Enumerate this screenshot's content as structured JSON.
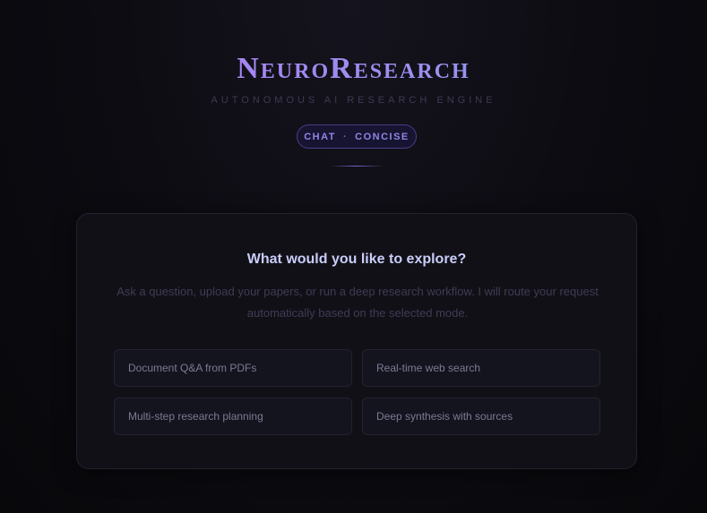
{
  "brand": {
    "name": "NeuroResearch",
    "tagline": "AUTONOMOUS AI RESEARCH ENGINE"
  },
  "mode": {
    "type": "CHAT",
    "separator": "·",
    "style": "CONCISE"
  },
  "welcome": {
    "title": "What would you like to explore?",
    "description": "Ask a question, upload your papers, or run a deep research workflow. I will route your request automatically based on the selected mode.",
    "options": [
      {
        "label": "Document Q&A from PDFs"
      },
      {
        "label": "Real-time web search"
      },
      {
        "label": "Multi-step research planning"
      },
      {
        "label": "Deep synthesis with sources"
      }
    ]
  },
  "colors": {
    "accent": "#9f8cf0",
    "background": "#0b0a10",
    "card": "#111016"
  }
}
